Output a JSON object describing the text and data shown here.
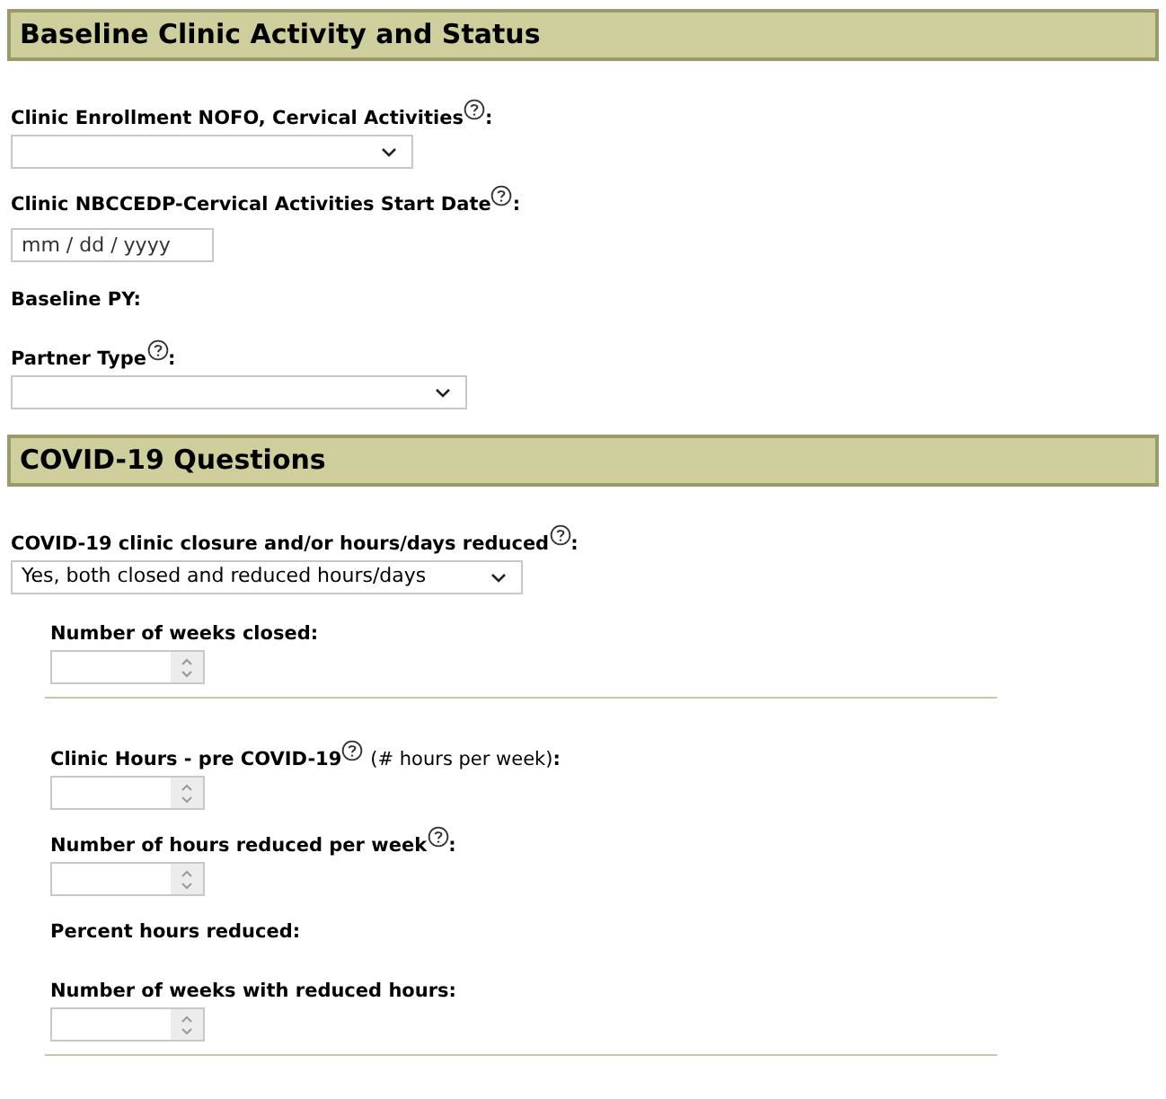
{
  "sections": [
    {
      "title": "Baseline Clinic Activity and Status",
      "fields": [
        {
          "kind": "select",
          "label": "Clinic Enrollment NOFO, Cervical Activities",
          "help": true,
          "after": ":"
        },
        {
          "kind": "date",
          "label": "Clinic NBCCEDP-Cervical Activities Start Date",
          "help": true,
          "after": ":",
          "placeholder": "mm / dd / yyyy"
        },
        {
          "kind": "text",
          "label": "Baseline PY:",
          "help": false
        },
        {
          "kind": "select",
          "label": "Partner Type",
          "help": true,
          "after": ":"
        }
      ]
    },
    {
      "title": "COVID-19 Questions",
      "fields": [
        {
          "kind": "select",
          "label": "COVID-19 clinic closure and/or hours/days reduced",
          "help": true,
          "after": ":",
          "value": "Yes, both closed and reduced hours/days",
          "groups": [
            {
              "fields": [
                {
                  "kind": "number",
                  "label": "Number of weeks closed:",
                  "help": false
                }
              ]
            },
            {
              "fields": [
                {
                  "kind": "number",
                  "label": "Clinic Hours - pre COVID-19",
                  "help": true,
                  "note": "(# hours per week)",
                  "after": ":"
                },
                {
                  "kind": "number",
                  "label": "Number of hours reduced per week",
                  "help": true,
                  "after": ":"
                },
                {
                  "kind": "text",
                  "label": "Percent hours reduced:",
                  "help": false
                },
                {
                  "kind": "number",
                  "label": "Number of weeks with reduced hours:",
                  "help": false
                }
              ]
            }
          ]
        }
      ]
    }
  ]
}
